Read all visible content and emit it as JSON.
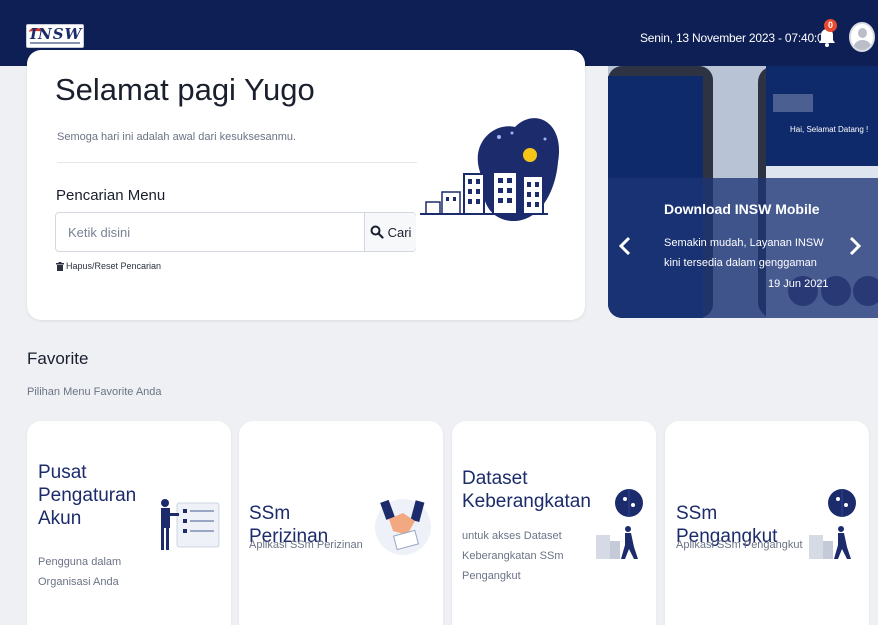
{
  "header": {
    "logo_text": "INSW",
    "datetime": "Senin, 13 November 2023 - 07:40:01",
    "notification_count": "0"
  },
  "welcome": {
    "greeting": "Selamat pagi Yugo",
    "subtitle": "Semoga hari ini adalah awal dari kesuksesanmu.",
    "search_title": "Pencarian Menu",
    "search_placeholder": "Ketik disini",
    "search_button": "Cari",
    "reset_link": "Hapus/Reset Pencarian"
  },
  "banner": {
    "title": "Download INSW Mobile",
    "description": "Semakin mudah, Layanan INSW kini tersedia dalam genggaman",
    "date": "19 Jun 2021",
    "phone_greeting": "Hai, Selamat Datang !"
  },
  "favorites": {
    "title": "Favorite",
    "subtitle": "Pilihan Menu Favorite Anda",
    "cards": [
      {
        "title": "Pusat Pengaturan Akun",
        "description": "Pengguna dalam Organisasi Anda",
        "icon": "account-settings-icon"
      },
      {
        "title": "SSm Perizinan",
        "description": "Aplikasi SSm Perizinan",
        "icon": "license-handshake-icon"
      },
      {
        "title": "Dataset Keberangkatan",
        "description": "untuk akses Dataset Keberangkatan SSm Pengangkut",
        "icon": "departure-logistics-icon"
      },
      {
        "title": "SSm Pengangkut",
        "description": "Aplikasi SSm Pengangkut",
        "icon": "carrier-logistics-icon"
      }
    ]
  },
  "colors": {
    "header_bg": "#0e1f55",
    "title_blue": "#1c2b6b",
    "badge": "#e8492f",
    "accent_yellow": "#f5c518"
  }
}
